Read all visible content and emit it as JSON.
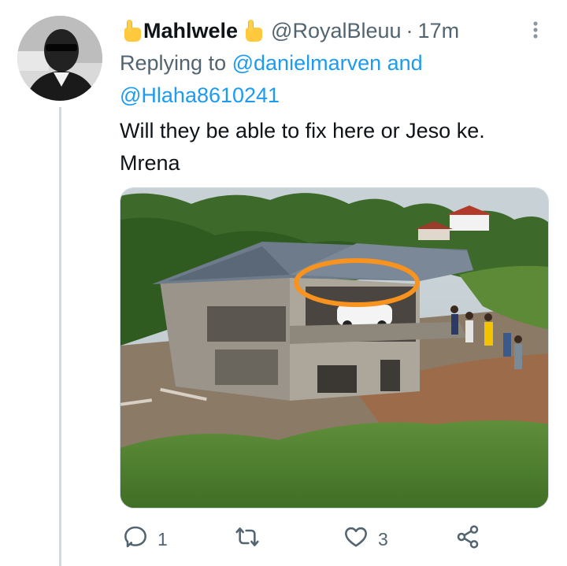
{
  "tweet": {
    "author_name": "Mahlwele",
    "author_handle": "@RoyalBleuu",
    "separator": "·",
    "timestamp": "17m",
    "name_emoji": "pointing-up-hand-icon",
    "replying_prefix": "Replying to",
    "reply_mention_1": "@danielmarven",
    "reply_and": "and",
    "reply_mention_2": "@Hlaha8610241",
    "text_line_1": "Will they be able to fix here or Jeso ke.",
    "text_line_2": "Mrena",
    "media_description_icon": "house-construction-photo"
  },
  "actions": {
    "reply_count": "1",
    "retweet_count": "",
    "like_count": "3"
  },
  "colors": {
    "accent": "#1d9bf0",
    "secondary_text": "#536471",
    "primary_text": "#0f1419",
    "thread_line": "#cfd9de",
    "highlight_circle": "#f7931e"
  }
}
